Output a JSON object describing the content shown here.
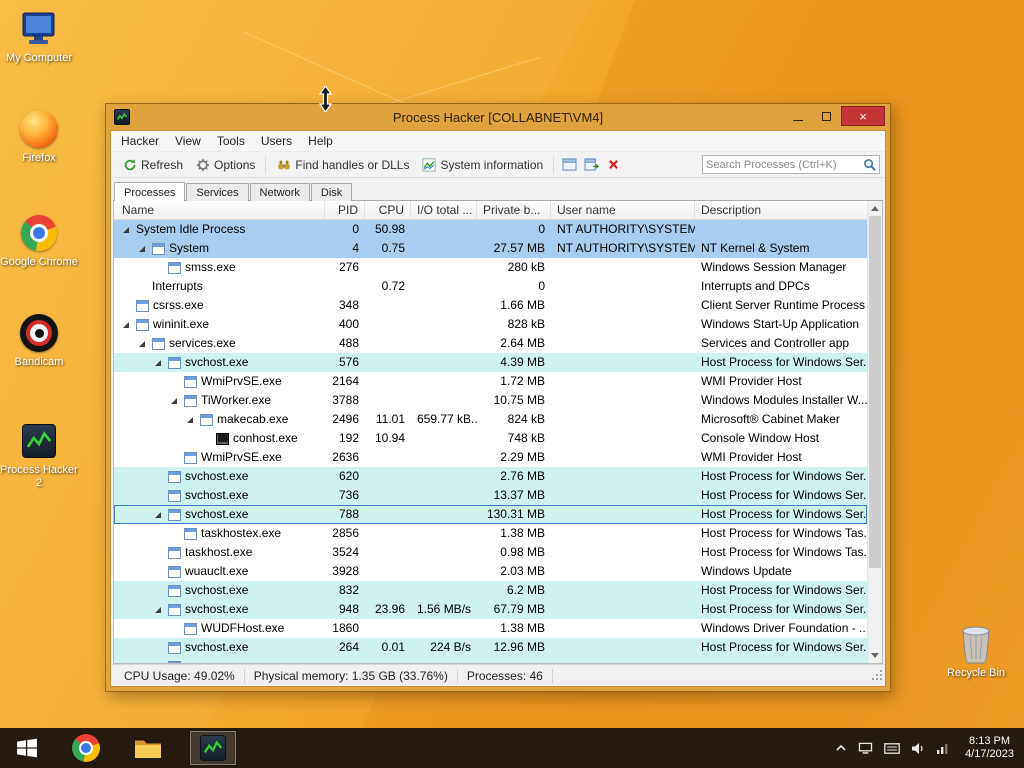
{
  "colors": {
    "titlebar": "#e1a23d",
    "close_button": "#c13535",
    "selection_row": "#a9cdee",
    "service_row": "#cdf2f0",
    "focused_row_border": "#3d7bc4",
    "desktop_orange": "#f4a92f",
    "taskbar": "#241a10"
  },
  "desktop": {
    "icons": [
      {
        "label": "My Computer"
      },
      {
        "label": "Firefox"
      },
      {
        "label": "Google Chrome"
      },
      {
        "label": "Bandicam"
      },
      {
        "label": "Process Hacker 2"
      },
      {
        "label": "Recycle Bin"
      }
    ]
  },
  "window": {
    "title": "Process Hacker [COLLABNET\\VM4]",
    "menus": [
      "Hacker",
      "View",
      "Tools",
      "Users",
      "Help"
    ],
    "toolbar": {
      "refresh": "Refresh",
      "options": "Options",
      "find_handles": "Find handles or DLLs",
      "system_information": "System information",
      "search_placeholder": "Search Processes (Ctrl+K)"
    },
    "tabs": [
      "Processes",
      "Services",
      "Network",
      "Disk"
    ],
    "active_tab": "Processes",
    "columns": [
      "Name",
      "PID",
      "CPU",
      "I/O total ...",
      "Private b...",
      "User name",
      "Description"
    ],
    "rows": [
      {
        "name": "System Idle Process",
        "pid": "0",
        "cpu": "50.98",
        "io": "",
        "priv": "0",
        "user": "NT AUTHORITY\\SYSTEM",
        "desc": "",
        "level": 0,
        "arrow": true,
        "icon": "none",
        "bg": "sel",
        "focused": false
      },
      {
        "name": "System",
        "pid": "4",
        "cpu": "0.75",
        "io": "",
        "priv": "27.57 MB",
        "user": "NT AUTHORITY\\SYSTEM",
        "desc": "NT Kernel & System",
        "level": 1,
        "arrow": true,
        "icon": "app",
        "bg": "sel",
        "focused": false
      },
      {
        "name": "smss.exe",
        "pid": "276",
        "cpu": "",
        "io": "",
        "priv": "280 kB",
        "user": "",
        "desc": "Windows Session Manager",
        "level": 2,
        "arrow": false,
        "icon": "app",
        "bg": "",
        "focused": false
      },
      {
        "name": "Interrupts",
        "pid": "",
        "cpu": "0.72",
        "io": "",
        "priv": "0",
        "user": "",
        "desc": "Interrupts and DPCs",
        "level": 1,
        "arrow": false,
        "icon": "none",
        "bg": "",
        "focused": false
      },
      {
        "name": "csrss.exe",
        "pid": "348",
        "cpu": "",
        "io": "",
        "priv": "1.66 MB",
        "user": "",
        "desc": "Client Server Runtime Process",
        "level": 0,
        "arrow": false,
        "icon": "app",
        "bg": "",
        "focused": false
      },
      {
        "name": "wininit.exe",
        "pid": "400",
        "cpu": "",
        "io": "",
        "priv": "828 kB",
        "user": "",
        "desc": "Windows Start-Up Application",
        "level": 0,
        "arrow": true,
        "icon": "app",
        "bg": "",
        "focused": false
      },
      {
        "name": "services.exe",
        "pid": "488",
        "cpu": "",
        "io": "",
        "priv": "2.64 MB",
        "user": "",
        "desc": "Services and Controller app",
        "level": 1,
        "arrow": true,
        "icon": "app",
        "bg": "",
        "focused": false
      },
      {
        "name": "svchost.exe",
        "pid": "576",
        "cpu": "",
        "io": "",
        "priv": "4.39 MB",
        "user": "",
        "desc": "Host Process for Windows Ser...",
        "level": 2,
        "arrow": true,
        "icon": "app",
        "bg": "svc",
        "focused": false
      },
      {
        "name": "WmiPrvSE.exe",
        "pid": "2164",
        "cpu": "",
        "io": "",
        "priv": "1.72 MB",
        "user": "",
        "desc": "WMI Provider Host",
        "level": 3,
        "arrow": false,
        "icon": "app",
        "bg": "",
        "focused": false
      },
      {
        "name": "TiWorker.exe",
        "pid": "3788",
        "cpu": "",
        "io": "",
        "priv": "10.75 MB",
        "user": "",
        "desc": "Windows Modules Installer W...",
        "level": 3,
        "arrow": true,
        "icon": "app",
        "bg": "",
        "focused": false
      },
      {
        "name": "makecab.exe",
        "pid": "2496",
        "cpu": "11.01",
        "io": "659.77 kB...",
        "priv": "824 kB",
        "user": "",
        "desc": "Microsoft® Cabinet Maker",
        "level": 4,
        "arrow": true,
        "icon": "app",
        "bg": "",
        "focused": false
      },
      {
        "name": "conhost.exe",
        "pid": "192",
        "cpu": "10.94",
        "io": "",
        "priv": "748 kB",
        "user": "",
        "desc": "Console Window Host",
        "level": 5,
        "arrow": false,
        "icon": "console",
        "bg": "",
        "focused": false
      },
      {
        "name": "WmiPrvSE.exe",
        "pid": "2636",
        "cpu": "",
        "io": "",
        "priv": "2.29 MB",
        "user": "",
        "desc": "WMI Provider Host",
        "level": 3,
        "arrow": false,
        "icon": "app",
        "bg": "",
        "focused": false
      },
      {
        "name": "svchost.exe",
        "pid": "620",
        "cpu": "",
        "io": "",
        "priv": "2.76 MB",
        "user": "",
        "desc": "Host Process for Windows Ser...",
        "level": 2,
        "arrow": false,
        "icon": "app",
        "bg": "svc",
        "focused": false
      },
      {
        "name": "svchost.exe",
        "pid": "736",
        "cpu": "",
        "io": "",
        "priv": "13.37 MB",
        "user": "",
        "desc": "Host Process for Windows Ser...",
        "level": 2,
        "arrow": false,
        "icon": "app",
        "bg": "svc",
        "focused": false
      },
      {
        "name": "svchost.exe",
        "pid": "788",
        "cpu": "",
        "io": "",
        "priv": "130.31 MB",
        "user": "",
        "desc": "Host Process for Windows Ser...",
        "level": 2,
        "arrow": true,
        "icon": "app",
        "bg": "svc",
        "focused": true
      },
      {
        "name": "taskhostex.exe",
        "pid": "2856",
        "cpu": "",
        "io": "",
        "priv": "1.38 MB",
        "user": "",
        "desc": "Host Process for Windows Tas...",
        "level": 3,
        "arrow": false,
        "icon": "app",
        "bg": "",
        "focused": false
      },
      {
        "name": "taskhost.exe",
        "pid": "3524",
        "cpu": "",
        "io": "",
        "priv": "0.98 MB",
        "user": "",
        "desc": "Host Process for Windows Tas...",
        "level": 2,
        "arrow": false,
        "icon": "app",
        "bg": "",
        "focused": false
      },
      {
        "name": "wuauclt.exe",
        "pid": "3928",
        "cpu": "",
        "io": "",
        "priv": "2.03 MB",
        "user": "",
        "desc": "Windows Update",
        "level": 2,
        "arrow": false,
        "icon": "app",
        "bg": "",
        "focused": false
      },
      {
        "name": "svchost.exe",
        "pid": "832",
        "cpu": "",
        "io": "",
        "priv": "6.2 MB",
        "user": "",
        "desc": "Host Process for Windows Ser...",
        "level": 2,
        "arrow": false,
        "icon": "app",
        "bg": "svc",
        "focused": false
      },
      {
        "name": "svchost.exe",
        "pid": "948",
        "cpu": "23.96",
        "io": "1.56 MB/s",
        "priv": "67.79 MB",
        "user": "",
        "desc": "Host Process for Windows Ser...",
        "level": 2,
        "arrow": true,
        "icon": "app",
        "bg": "svc",
        "focused": false
      },
      {
        "name": "WUDFHost.exe",
        "pid": "1860",
        "cpu": "",
        "io": "",
        "priv": "1.38 MB",
        "user": "",
        "desc": "Windows Driver Foundation - ...",
        "level": 3,
        "arrow": false,
        "icon": "app",
        "bg": "",
        "focused": false
      },
      {
        "name": "svchost.exe",
        "pid": "264",
        "cpu": "0.01",
        "io": "224 B/s",
        "priv": "12.96 MB",
        "user": "",
        "desc": "Host Process for Windows Ser...",
        "level": 2,
        "arrow": false,
        "icon": "app",
        "bg": "svc",
        "focused": false
      },
      {
        "name": "",
        "pid": "",
        "cpu": "",
        "io": "",
        "priv": "",
        "user": "",
        "desc": "",
        "level": 2,
        "arrow": false,
        "icon": "app",
        "bg": "svc",
        "focused": false
      }
    ],
    "statusbar": [
      "CPU Usage: 49.02%",
      "Physical memory: 1.35 GB (33.76%)",
      "Processes: 46"
    ]
  },
  "taskbar": {
    "time": "8:13 PM",
    "date": "4/17/2023"
  }
}
